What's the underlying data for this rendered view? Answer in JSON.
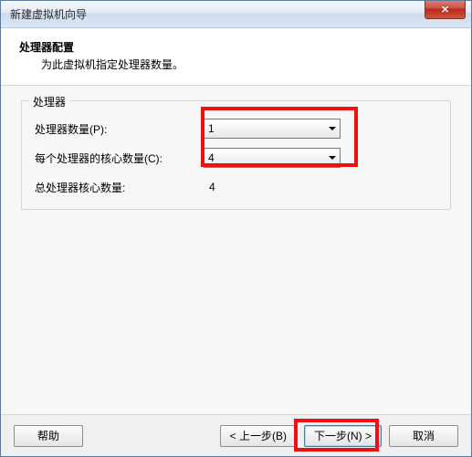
{
  "window": {
    "title": "新建虚拟机向导"
  },
  "header": {
    "title": "处理器配置",
    "subtitle": "为此虚拟机指定处理器数量。"
  },
  "group": {
    "legend": "处理器",
    "rows": {
      "proc_count_label": "处理器数量(P):",
      "proc_count_value": "1",
      "cores_per_label": "每个处理器的核心数量(C):",
      "cores_per_value": "4",
      "total_label": "总处理器核心数量:",
      "total_value": "4"
    }
  },
  "footer": {
    "help": "帮助",
    "back": "< 上一步(B)",
    "next": "下一步(N) >",
    "cancel": "取消"
  },
  "icons": {
    "close": "✕"
  }
}
